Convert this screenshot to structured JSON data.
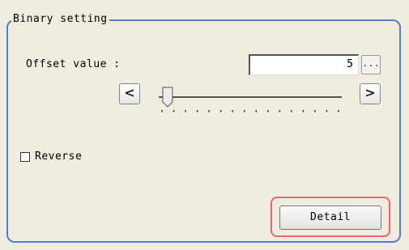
{
  "group": {
    "title": "Binary setting"
  },
  "offset": {
    "label": "Offset value :",
    "value": "5",
    "browse_label": "...",
    "decrement_label": "<",
    "increment_label": ">",
    "slider_level": 0.04
  },
  "reverse": {
    "label": "Reverse",
    "checked": false
  },
  "detail": {
    "label": "Detail"
  },
  "colors": {
    "frame": "#4f7fd0",
    "highlight": "#e8666e",
    "background": "#f0ece0"
  },
  "icons": {
    "decrement": "chevron-left-icon",
    "increment": "chevron-right-icon"
  }
}
